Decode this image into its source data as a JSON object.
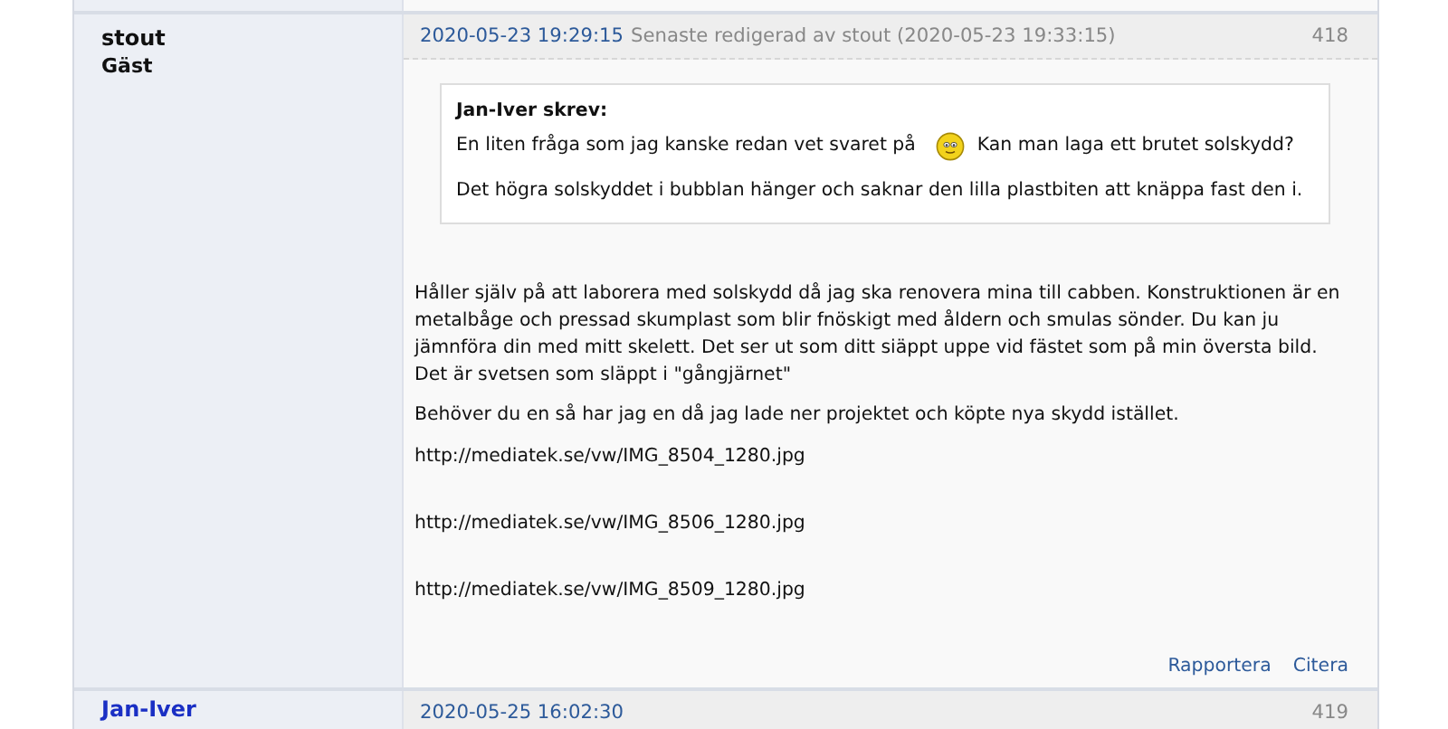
{
  "posts": [
    {
      "author": "stout",
      "role": "Gäst",
      "date": "2020-05-23 19:29:15",
      "edited": "Senaste redigerad av stout (2020-05-23 19:33:15)",
      "number": "418",
      "quote": {
        "header": "Jan-Iver skrev:",
        "paragraphs": [
          [
            {
              "kind": "text",
              "text": "En liten fråga som jag kanske redan vet svaret på"
            },
            {
              "kind": "smiley"
            },
            {
              "kind": "text",
              "text": "Kan man laga ett brutet solskydd?"
            }
          ],
          [
            {
              "kind": "text",
              "text": "Det högra solskyddet i bubblan hänger och saknar den lilla plastbiten att knäppa fast den i."
            }
          ]
        ]
      },
      "paragraphs": [
        "Håller själv på att laborera med solskydd då jag ska renovera mina till cabben. Konstruktionen är en metalbåge och pressad skumplast som blir fnöskigt med åldern och smulas sönder. Du kan ju jämnföra din med mitt skelett. Det ser ut som ditt siäppt uppe vid fästet som på min översta bild. Det är svetsen som släppt i \"gångjärnet\"",
        "Behöver du en så har jag en då jag lade ner projektet och köpte nya skydd istället."
      ],
      "links": [
        "http://mediatek.se/vw/IMG_8504_1280.jpg",
        "http://mediatek.se/vw/IMG_8506_1280.jpg",
        "http://mediatek.se/vw/IMG_8509_1280.jpg"
      ],
      "actions": [
        "Rapportera",
        "Citera"
      ]
    },
    {
      "author": "Jan-Iver",
      "date": "2020-05-25 16:02:30",
      "number": "419"
    }
  ]
}
